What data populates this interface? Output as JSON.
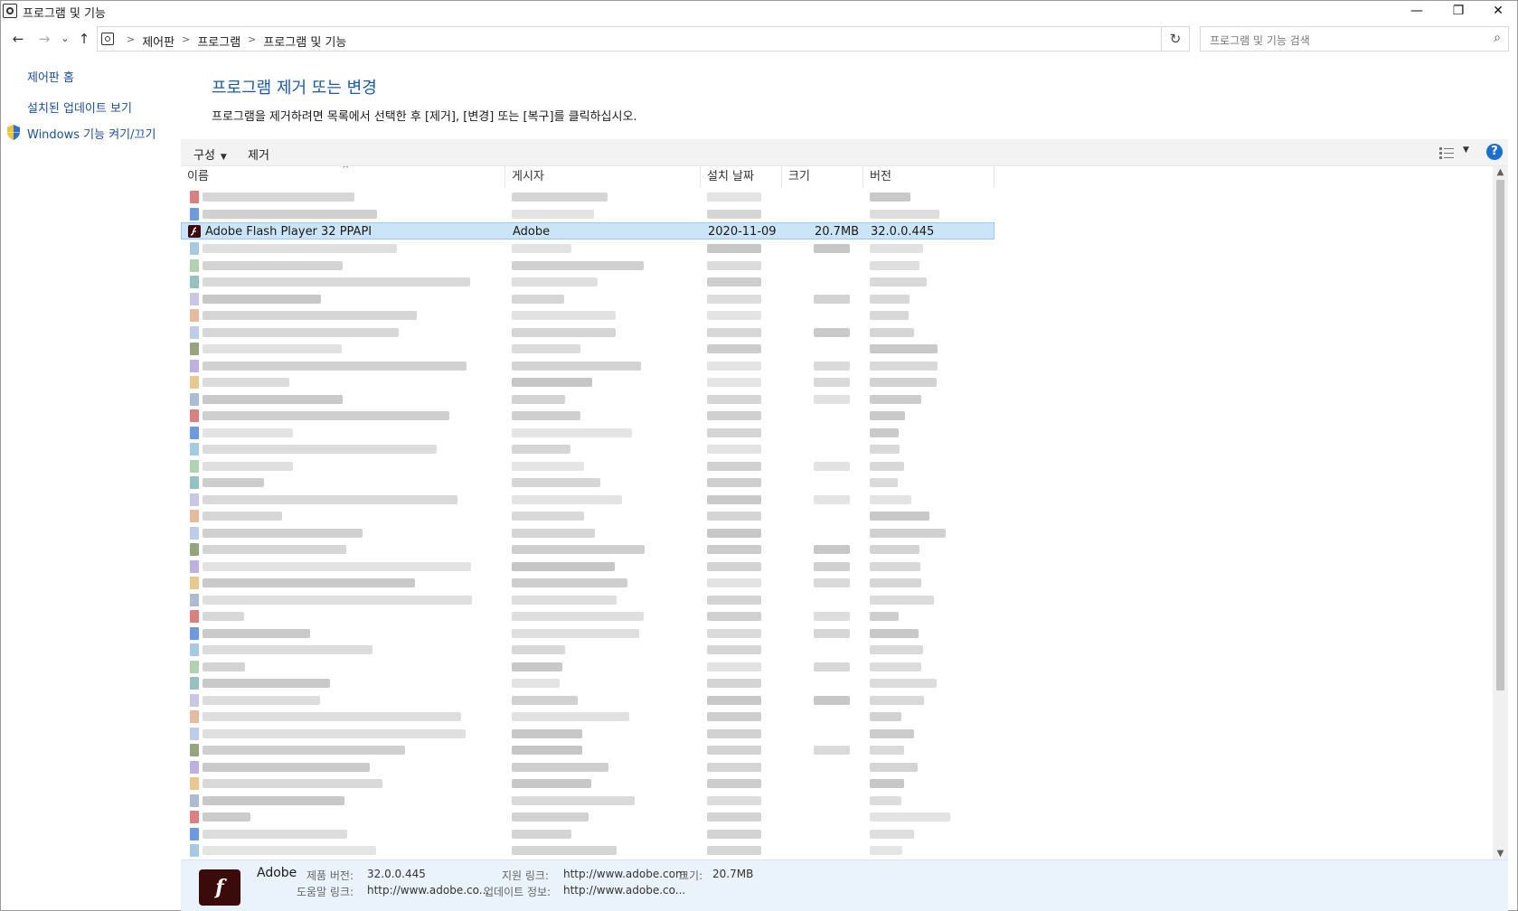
{
  "window": {
    "title": "프로그램 및 기능",
    "controls": {
      "minimize": "—",
      "restore": "❐",
      "close": "✕"
    }
  },
  "nav": {
    "back": "←",
    "forward": "→",
    "recent": "⌄",
    "up": "↑",
    "breadcrumbs": [
      "제어판",
      "프로그램",
      "프로그램 및 기능"
    ],
    "dropdown": "⌄",
    "refresh": "↻",
    "search_placeholder": "프로그램 및 기능 검색",
    "search_icon": "⌕"
  },
  "sidebar": {
    "home": "제어판 홈",
    "installed_updates": "설치된 업데이트 보기",
    "windows_features": "Windows 기능 켜기/끄기"
  },
  "main": {
    "heading": "프로그램 제거 또는 변경",
    "description": "프로그램을 제거하려면 목록에서 선택한 후 [제거], [변경] 또는 [복구]를 클릭하십시오."
  },
  "toolbar": {
    "organize": "구성",
    "organize_arrow": "▼",
    "uninstall": "제거",
    "view_arrow": "▼",
    "help": "?"
  },
  "table": {
    "columns": [
      "이름",
      "게시자",
      "설치 날짜",
      "크기",
      "버전"
    ],
    "sort_indicator": "^",
    "selected_row": {
      "name": "Adobe Flash Player 32 PPAPI",
      "publisher": "Adobe",
      "installed_on": "2020-11-09",
      "size": "20.7MB",
      "version": "32.0.0.445"
    }
  },
  "scrollbar": {
    "up": "▲",
    "down": "▼"
  },
  "details": {
    "publisher": "Adobe",
    "product_version_label": "제품 버전:",
    "product_version": "32.0.0.445",
    "support_link_label": "지원 링크:",
    "support_link": "http://www.adobe.com",
    "size_label": "크기:",
    "size": "20.7MB",
    "help_link_label": "도움말 링크:",
    "help_link": "http://www.adobe.co...",
    "update_info_label": "업데이트 정보:",
    "update_info": "http://www.adobe.co..."
  },
  "colors": {
    "link": "#1d4e9a",
    "heading": "#1d5ba8",
    "selection": "#cce4f7",
    "details_bg": "#eaf2fb"
  }
}
